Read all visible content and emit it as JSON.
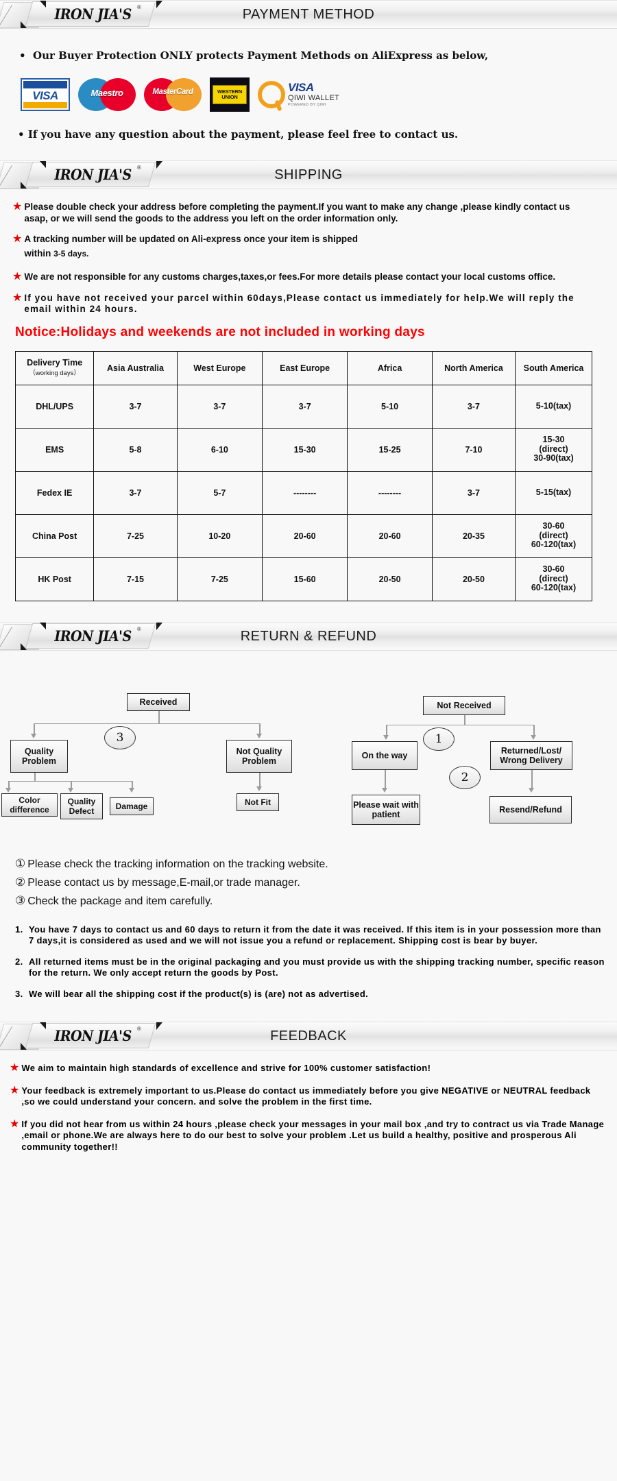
{
  "brand": {
    "name": "IRON JIA'S",
    "registered_mark": "®"
  },
  "sections": {
    "payment": {
      "title": "PAYMENT METHOD",
      "line1": "Our Buyer Protection ONLY protects Payment Methods on AliExpress as below,",
      "line2": "If you have any question about the payment, please feel free to contact us.",
      "icons": [
        {
          "name": "visa-icon",
          "label": "VISA"
        },
        {
          "name": "maestro-icon",
          "label": "Maestro"
        },
        {
          "name": "mastercard-icon",
          "label": "MasterCard"
        },
        {
          "name": "western-union-icon",
          "label_top": "WESTERN",
          "label_bottom": "UNION"
        },
        {
          "name": "qiwi-wallet-icon",
          "label": "VISA",
          "sub": "QIWI WALLET",
          "powered": "POWERED BY QIWI"
        }
      ]
    },
    "shipping": {
      "title": "SHIPPING",
      "items": [
        "Please double check your address before completing the payment.If you want to make any change ,please kindly contact us asap, or we will send the goods to the address you left on the order information only.",
        "A tracking number will be updated on Ali-express once your item is shipped",
        "We are not responsible for any customs charges,taxes,or fees.For more details please contact your local customs office.",
        "If you have not received your parcel within  60days,Please contact us immediately for help.We will reply the email within 24 hours."
      ],
      "item2_continuation_prefix": "within",
      "item2_continuation_small": "3-5 days.",
      "notice": "Notice:Holidays and weekends are not included in working days",
      "table": {
        "header_main": "Delivery Time",
        "header_sub": "（working days）",
        "columns": [
          "Asia Australia",
          "West Europe",
          "East Europe",
          "Africa",
          "North America",
          "South America"
        ],
        "rows": [
          {
            "label": "DHL/UPS",
            "cells": [
              "3-7",
              "3-7",
              "3-7",
              "5-10",
              "3-7",
              "5-10(tax)"
            ]
          },
          {
            "label": "EMS",
            "cells": [
              "5-8",
              "6-10",
              "15-30",
              "15-25",
              "7-10",
              "15-30\n(direct)\n30-90(tax)"
            ]
          },
          {
            "label": "Fedex IE",
            "cells": [
              "3-7",
              "5-7",
              "--------",
              "--------",
              "3-7",
              "5-15(tax)"
            ]
          },
          {
            "label": "China Post",
            "cells": [
              "7-25",
              "10-20",
              "20-60",
              "20-60",
              "20-35",
              "30-60\n(direct)\n60-120(tax)"
            ]
          },
          {
            "label": "HK Post",
            "cells": [
              "7-15",
              "7-25",
              "15-60",
              "20-50",
              "20-50",
              "30-60\n(direct)\n60-120(tax)"
            ]
          }
        ]
      }
    },
    "return": {
      "title": "RETURN & REFUND",
      "flow": {
        "received": "Received",
        "quality_problem": "Quality Problem",
        "not_quality_problem": "Not Quality Problem",
        "color_difference": "Color difference",
        "quality_defect": "Quality Defect",
        "damage": "Damage",
        "not_fit": "Not Fit",
        "not_received": "Not  Received",
        "on_the_way": "On the way",
        "returned_lost_wrong": "Returned/Lost/ Wrong Delivery",
        "please_wait": "Please wait with patient",
        "resend_refund": "Resend/Refund",
        "marker_1": "1",
        "marker_2": "2",
        "marker_3": "3"
      },
      "circled_notes": [
        {
          "num": "①",
          "text": "Please check the tracking information on the tracking website."
        },
        {
          "num": "②",
          "text": "Please contact us by  message,E-mail,or trade manager."
        },
        {
          "num": "③",
          "text": "Check the package and item carefully."
        }
      ],
      "terms": [
        {
          "num": "1.",
          "text": "You have 7 days to contact us and 60 days to return it from the date it was received. If this item is in your possession more than 7 days,it is considered as used and we will not issue you a refund or replacement. Shipping cost is bear by buyer."
        },
        {
          "num": "2.",
          "text": "All returned items must be in the original packaging and you must provide us with the shipping tracking number, specific reason for the return. We only accept return the goods by Post."
        },
        {
          "num": "3.",
          "text": "We will bear all the shipping cost if the product(s) is (are) not as advertised."
        }
      ]
    },
    "feedback": {
      "title": "FEEDBACK",
      "items": [
        "We aim to maintain high standards of excellence and strive  for 100% customer satisfaction!",
        "Your feedback is extremely important to us.Please do contact us immediately before you give NEGATIVE or NEUTRAL feedback ,so  we could understand your concern. and solve the problem in the first time.",
        "If you did not hear from us within 24 hours ,please check your messages in your mail box ,and try to contract us via Trade Manage ,email or phone.We are always here to do our best to solve your problem .Let us build a healthy, positive and prosperous Ali community together!!"
      ]
    }
  },
  "colors": {
    "notice_red": "#ff0000",
    "star_red": "#e60000",
    "visa_blue": "#1a4f9c",
    "visa_gold": "#f2a900",
    "maestro_blue": "#2b8cc4",
    "maestro_red": "#e8002a",
    "mastercard_orange": "#f0a12e",
    "wu_yellow": "#f5d400",
    "qiwi_orange": "#f2a11c"
  }
}
